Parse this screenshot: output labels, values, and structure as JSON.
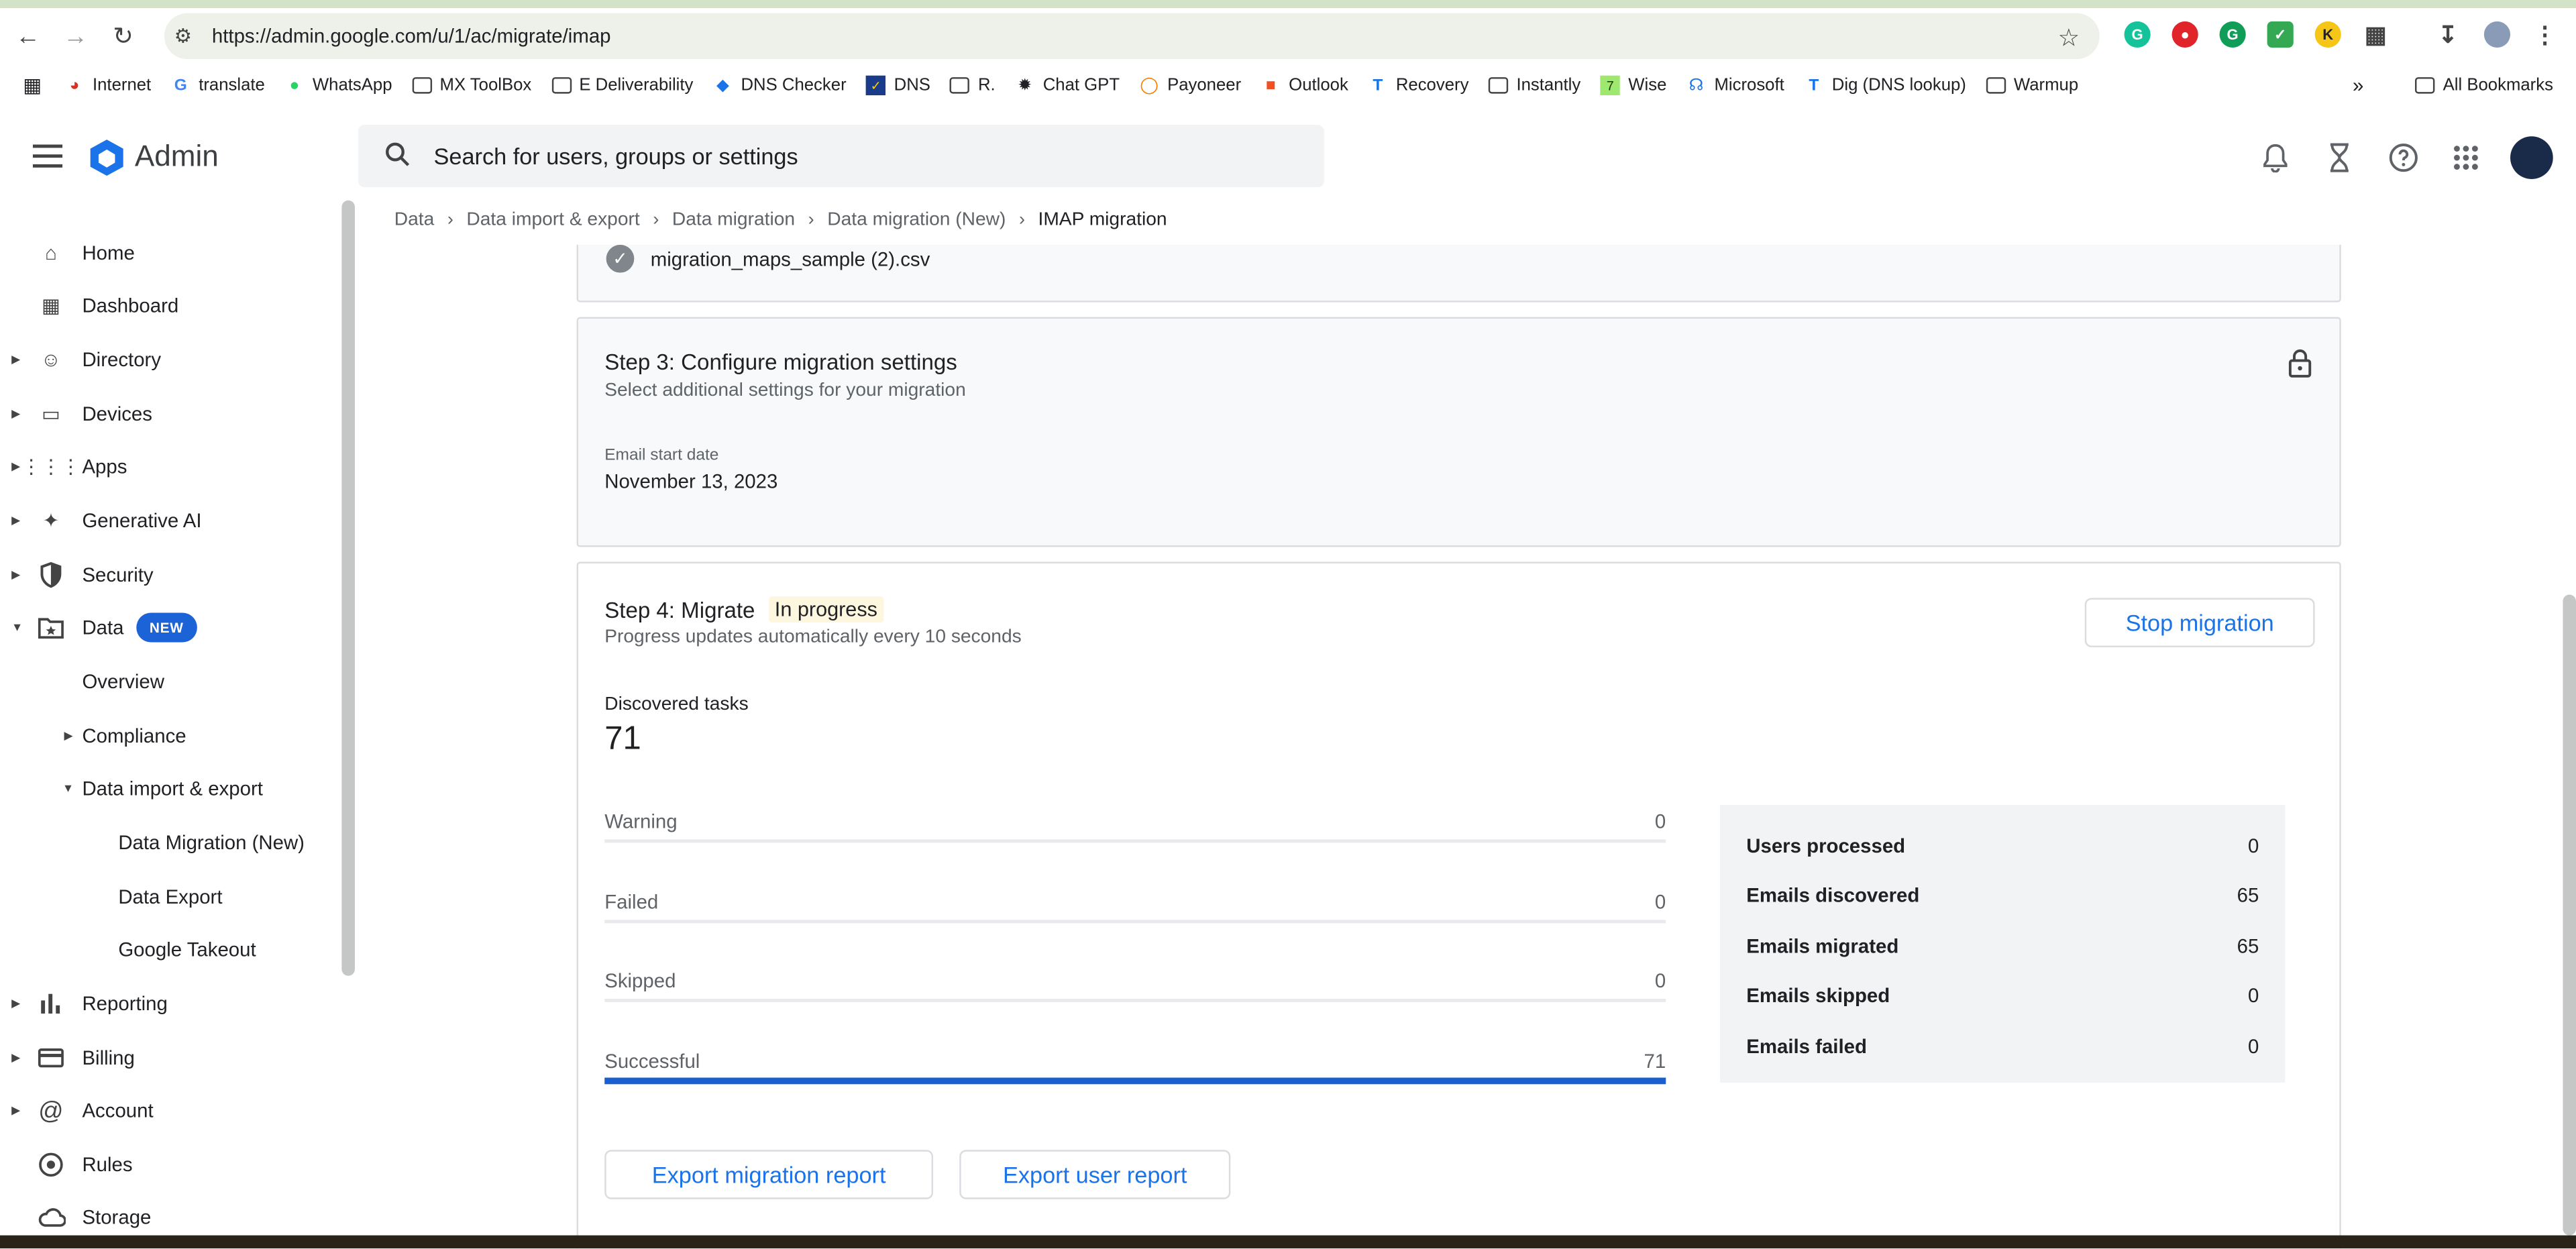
{
  "browser": {
    "url": "https://admin.google.com/u/1/ac/migrate/imap",
    "bookmarks": [
      "Internet",
      "translate",
      "WhatsApp",
      "MX ToolBox",
      "E Deliverability",
      "DNS Checker",
      "DNS",
      "R.",
      "Chat GPT",
      "Payoneer",
      "Outlook",
      "Recovery",
      "Instantly",
      "Wise",
      "Microsoft",
      "Dig (DNS lookup)",
      "Warmup"
    ],
    "all_bookmarks": "All Bookmarks",
    "more": "»"
  },
  "header": {
    "app_name": "Admin",
    "search_placeholder": "Search for users, groups or settings"
  },
  "sidebar": {
    "items": [
      {
        "label": "Home",
        "icon": "home-icon"
      },
      {
        "label": "Dashboard",
        "icon": "dashboard-icon"
      },
      {
        "label": "Directory",
        "icon": "person-icon"
      },
      {
        "label": "Devices",
        "icon": "devices-icon"
      },
      {
        "label": "Apps",
        "icon": "apps-icon"
      },
      {
        "label": "Generative AI",
        "icon": "sparkle-icon"
      },
      {
        "label": "Security",
        "icon": "shield-icon"
      },
      {
        "label": "Data",
        "icon": "folder-star-icon",
        "badge": "NEW"
      },
      {
        "label": "Overview"
      },
      {
        "label": "Compliance"
      },
      {
        "label": "Data import & export"
      },
      {
        "label": "Data Migration (New)"
      },
      {
        "label": "Data Export"
      },
      {
        "label": "Google Takeout"
      },
      {
        "label": "Reporting",
        "icon": "bar-chart-icon"
      },
      {
        "label": "Billing",
        "icon": "credit-card-icon"
      },
      {
        "label": "Account",
        "icon": "at-icon"
      },
      {
        "label": "Rules",
        "icon": "rules-icon"
      },
      {
        "label": "Storage",
        "icon": "cloud-icon"
      }
    ]
  },
  "breadcrumb": [
    "Data",
    "Data import & export",
    "Data migration",
    "Data migration (New)",
    "IMAP migration"
  ],
  "file": {
    "name": "migration_maps_sample (2).csv"
  },
  "step3": {
    "title": "Step 3: Configure migration settings",
    "subtitle": "Select additional settings for your migration",
    "field_label": "Email start date",
    "field_value": "November 13, 2023"
  },
  "step4": {
    "title": "Step 4: Migrate",
    "status": "In progress",
    "subtitle": "Progress updates automatically every 10 seconds",
    "stop_label": "Stop migration",
    "discovered_label": "Discovered tasks",
    "discovered_value": "71",
    "rows": [
      {
        "label": "Warning",
        "value": "0"
      },
      {
        "label": "Failed",
        "value": "0"
      },
      {
        "label": "Skipped",
        "value": "0"
      },
      {
        "label": "Successful",
        "value": "71"
      }
    ],
    "stats": [
      {
        "label": "Users processed",
        "value": "0"
      },
      {
        "label": "Emails discovered",
        "value": "65"
      },
      {
        "label": "Emails migrated",
        "value": "65"
      },
      {
        "label": "Emails skipped",
        "value": "0"
      },
      {
        "label": "Emails failed",
        "value": "0"
      }
    ],
    "export_migration": "Export migration report",
    "export_user": "Export user report"
  },
  "colors": {
    "accent": "#1a73e8",
    "progress": "#1a5fd0",
    "pill": "#fef7e0"
  }
}
